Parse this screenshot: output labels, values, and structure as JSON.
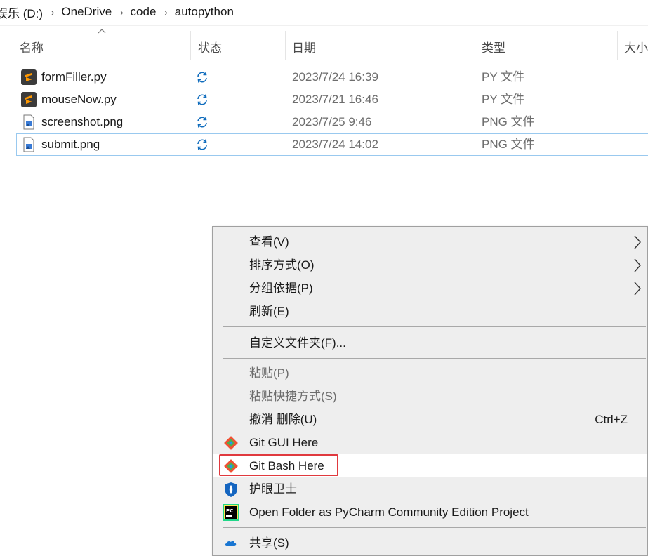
{
  "breadcrumb": [
    "娱乐 (D:)",
    "OneDrive",
    "code",
    "autopython"
  ],
  "breadcrumb_separator": "›",
  "columns": {
    "name": "名称",
    "status": "状态",
    "date": "日期",
    "type": "类型",
    "size": "大小"
  },
  "files": [
    {
      "name": "formFiller.py",
      "date": "2023/7/24 16:39",
      "type": "PY 文件",
      "icon": "python-file-icon",
      "status_icon": "sync-icon"
    },
    {
      "name": "mouseNow.py",
      "date": "2023/7/21 16:46",
      "type": "PY 文件",
      "icon": "python-file-icon",
      "status_icon": "sync-icon"
    },
    {
      "name": "screenshot.png",
      "date": "2023/7/25 9:46",
      "type": "PNG 文件",
      "icon": "image-file-icon",
      "status_icon": "sync-icon"
    },
    {
      "name": "submit.png",
      "date": "2023/7/24 14:02",
      "type": "PNG 文件",
      "icon": "image-file-icon",
      "status_icon": "sync-icon",
      "selected": true
    }
  ],
  "context_menu": {
    "view": "查看(V)",
    "sort_by": "排序方式(O)",
    "group_by": "分组依据(P)",
    "refresh": "刷新(E)",
    "customize_folder": "自定义文件夹(F)...",
    "paste": "粘贴(P)",
    "paste_shortcut": "粘贴快捷方式(S)",
    "undo_delete": "撤消 删除(U)",
    "undo_shortcut": "Ctrl+Z",
    "git_gui": "Git GUI Here",
    "git_bash": "Git Bash Here",
    "eye_guard": "护眼卫士",
    "pycharm": "Open Folder as PyCharm Community Edition Project",
    "share": "共享(S)"
  },
  "colors": {
    "selection_border": "#99c9ef",
    "sync_icon": "#0f6cbd",
    "highlight_box": "#e0393e",
    "menu_background": "#eeeeee"
  }
}
